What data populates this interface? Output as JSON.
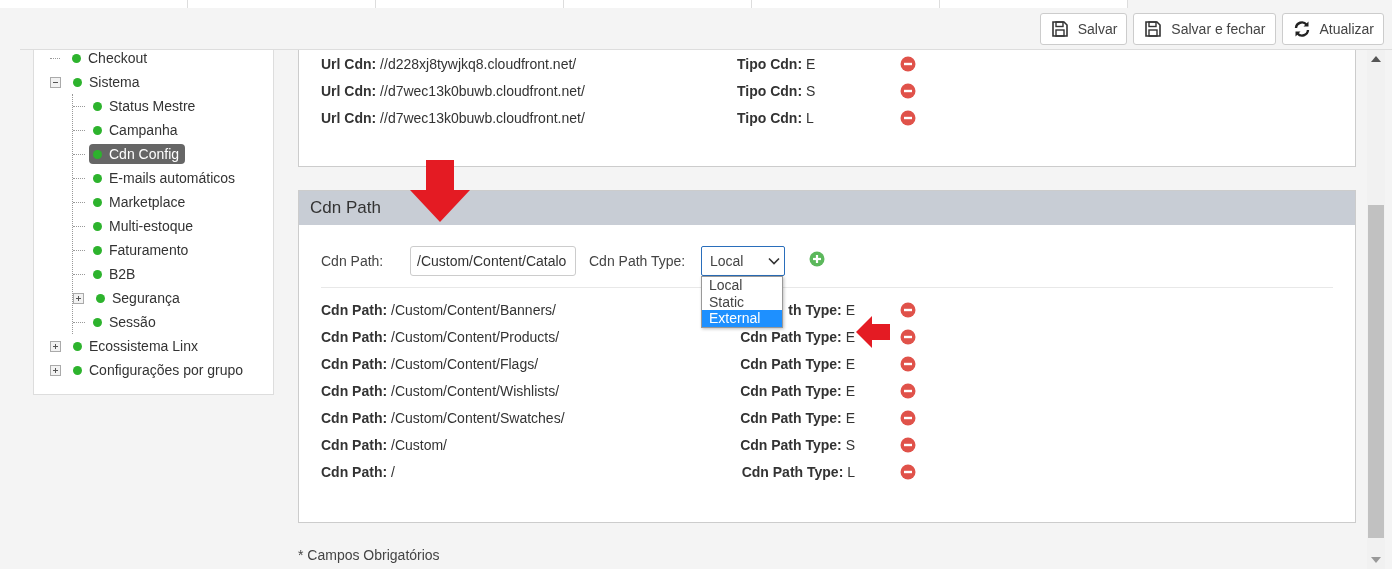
{
  "toolbar": {
    "buttons": [
      {
        "kind": "save",
        "label": "Salvar"
      },
      {
        "kind": "save",
        "label": "Salvar e fechar"
      },
      {
        "kind": "refresh",
        "label": "Atualizar"
      }
    ]
  },
  "sidebar": {
    "tree": [
      {
        "label": "Checkout",
        "selected": false
      },
      {
        "label": "Sistema",
        "selected": false,
        "expanded": true,
        "children": [
          {
            "label": "Status Mestre",
            "selected": false
          },
          {
            "label": "Campanha",
            "selected": false
          },
          {
            "label": "Cdn Config",
            "selected": true
          },
          {
            "label": "E-mails automáticos",
            "selected": false
          },
          {
            "label": "Marketplace",
            "selected": false
          },
          {
            "label": "Multi-estoque",
            "selected": false
          },
          {
            "label": "Faturamento",
            "selected": false
          },
          {
            "label": "B2B",
            "selected": false
          },
          {
            "label": "Segurança",
            "selected": false,
            "expanded": false
          },
          {
            "label": "Sessão",
            "selected": false
          }
        ]
      },
      {
        "label": "Ecossistema Linx",
        "selected": false,
        "expanded": false
      },
      {
        "label": "Configurações por grupo",
        "selected": false,
        "expanded": false
      }
    ]
  },
  "cdn_urls": {
    "rows": [
      {
        "url": "**Url Cdn:** //d228xj8tywjkq8.cloudfront.net/",
        "type": "**Tipo Cdn:** E"
      },
      {
        "url": "**Url Cdn:** //d7wec13k0buwb.cloudfront.net/",
        "type": "**Tipo Cdn:** S"
      },
      {
        "url": "**Url Cdn:** //d7wec13k0buwb.cloudfront.net/",
        "type": "**Tipo Cdn:** L"
      }
    ]
  },
  "cdn_path": {
    "title": "Cdn Path",
    "form": {
      "path_label": "Cdn Path:",
      "path_value": "/Custom/Content/Catalo",
      "type_label": "Cdn Path Type:",
      "type_value": "Local",
      "options": [
        {
          "label": "Local",
          "selected": false
        },
        {
          "label": "Static",
          "selected": false
        },
        {
          "label": "External",
          "selected": true
        }
      ]
    },
    "rows": [
      {
        "path": "**Cdn Path:** /Custom/Content/Banners/",
        "type": "**th Type:** E"
      },
      {
        "path": "**Cdn Path:** /Custom/Content/Products/",
        "type": "**Cdn Path Type:** E"
      },
      {
        "path": "**Cdn Path:** /Custom/Content/Flags/",
        "type": "**Cdn Path Type:** E"
      },
      {
        "path": "**Cdn Path:** /Custom/Content/Wishlists/",
        "type": "**Cdn Path Type:** E"
      },
      {
        "path": "**Cdn Path:** /Custom/Content/Swatches/",
        "type": "**Cdn Path Type:** E"
      },
      {
        "path": "**Cdn Path:** /Custom/",
        "type": "**Cdn Path Type:** S"
      },
      {
        "path": "**Cdn Path:** /",
        "type": "**Cdn Path Type:** L"
      }
    ]
  },
  "footer": {
    "note": "* Campos Obrigatórios"
  }
}
